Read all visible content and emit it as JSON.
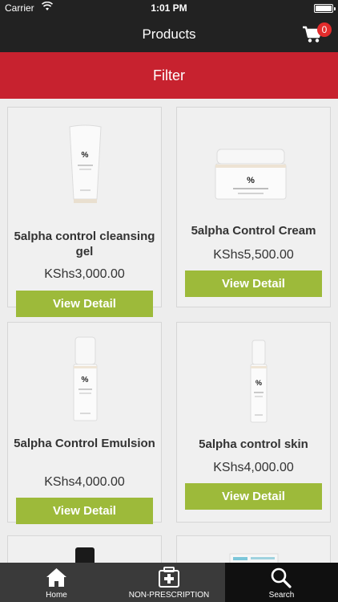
{
  "status": {
    "carrier": "Carrier",
    "time": "1:01 PM"
  },
  "nav": {
    "title": "Products",
    "cart_count": "0"
  },
  "filter": {
    "label": "Filter"
  },
  "products": [
    {
      "name": "5alpha control cleansing gel",
      "price": "KShs3,000.00",
      "button": "View Detail"
    },
    {
      "name": "5alpha Control Cream",
      "price": "KShs5,500.00",
      "button": "View Detail"
    },
    {
      "name": "5alpha Control Emulsion",
      "price": "KShs4,000.00",
      "button": "View Detail"
    },
    {
      "name": "5alpha control skin",
      "price": "KShs4,000.00",
      "button": "View Detail"
    }
  ],
  "tabs": [
    {
      "label": "Home",
      "icon": "home-icon"
    },
    {
      "label": "NON-PRESCRIPTION",
      "icon": "medical-kit-icon"
    },
    {
      "label": "Search",
      "icon": "search-icon"
    }
  ]
}
